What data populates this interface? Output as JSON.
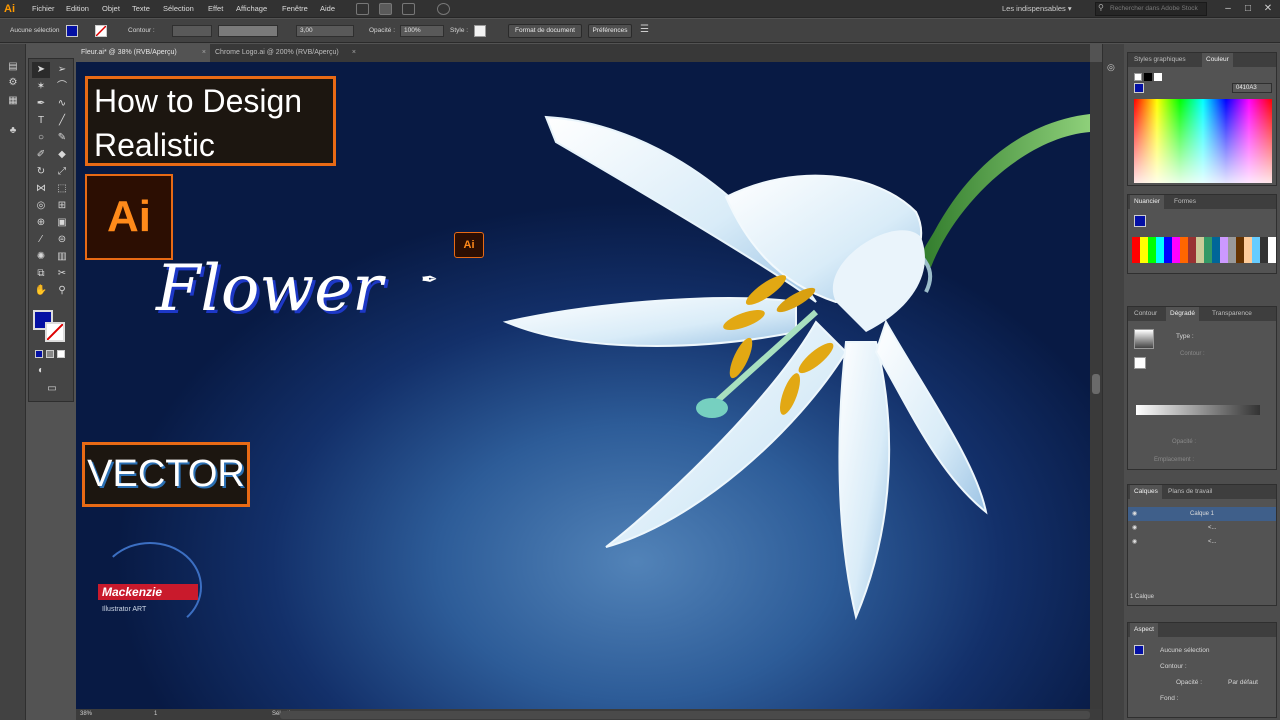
{
  "app": {
    "logo": "Ai",
    "accent": "#ff9a00"
  },
  "menu": {
    "items": [
      "Fichier",
      "Edition",
      "Objet",
      "Texte",
      "Sélection",
      "Effet",
      "Affichage",
      "Fenêtre",
      "Aide"
    ]
  },
  "workspace": {
    "label": "Les indispensables ▾",
    "search_placeholder": "Rechercher dans Adobe Stock"
  },
  "control_bar": {
    "selection": "Aucune sélection",
    "stroke_label": "Contour :",
    "stroke_size": "3,00",
    "opacity_label": "Opacité :",
    "opacity_value": "100%",
    "style_label": "Style :",
    "doc_format_button": "Format de document",
    "prefs_button": "Préférences"
  },
  "tabs": [
    {
      "label": "Fleur.ai* @ 38% (RVB/Aperçu)",
      "active": true
    },
    {
      "label": "Chrome Logo.ai @ 200% (RVB/Aperçu)",
      "active": false
    }
  ],
  "canvas": {
    "title_line1": "How to Design",
    "title_line2": "Realistic",
    "ai_badge": "Ai",
    "script_word": "Flower",
    "vector_label": "VECTOR",
    "signature_name": "Mackenzie",
    "signature_sub": "Illustrator ART",
    "pen_badge": "Ai"
  },
  "statusbar": {
    "zoom": "38%",
    "page": "1",
    "mode": "Sélection"
  },
  "panels": {
    "top_tabs": [
      "Styles graphiques",
      "Couleur"
    ],
    "hex_value": "0410A3",
    "swatch_tabs": [
      "Nuancier",
      "Formes"
    ],
    "gradient_tabs": [
      "Contour",
      "Dégradé",
      "Transparence"
    ],
    "gradient_type_label": "Type :",
    "gradient_stroke_label": "Contour :",
    "opacity_label": "Opacité :",
    "location_label": "Emplacement :",
    "layers_tabs": [
      "Calques",
      "Plans de travail"
    ],
    "layer_name": "Calque 1",
    "sublayer_labels": [
      "<...",
      "<..."
    ],
    "layers_count": "1 Calque",
    "appearance_tab": "Aspect",
    "appearance_none": "Aucune sélection",
    "appearance_stroke": "Contour :",
    "appearance_opacity_label": "Opacité :",
    "appearance_opacity_value": "Par défaut",
    "appearance_fill": "Fond :"
  },
  "colors": {
    "fill": "#0410A3",
    "orange_border": "#e86a15",
    "stem_green": "#3f8f3a",
    "pollen": "#e2a813"
  }
}
